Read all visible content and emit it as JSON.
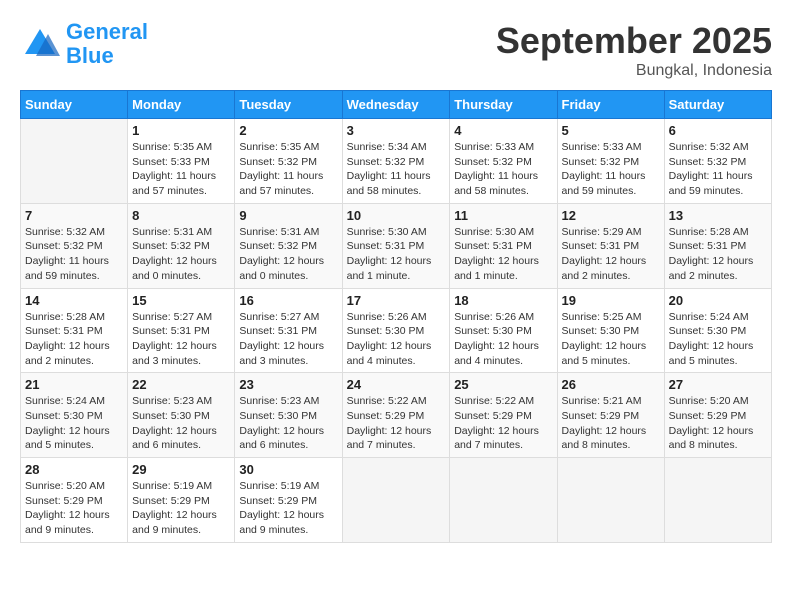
{
  "logo": {
    "line1": "General",
    "line2": "Blue"
  },
  "title": "September 2025",
  "subtitle": "Bungkal, Indonesia",
  "days_of_week": [
    "Sunday",
    "Monday",
    "Tuesday",
    "Wednesday",
    "Thursday",
    "Friday",
    "Saturday"
  ],
  "weeks": [
    [
      {
        "day": "",
        "info": ""
      },
      {
        "day": "1",
        "info": "Sunrise: 5:35 AM\nSunset: 5:33 PM\nDaylight: 11 hours\nand 57 minutes."
      },
      {
        "day": "2",
        "info": "Sunrise: 5:35 AM\nSunset: 5:32 PM\nDaylight: 11 hours\nand 57 minutes."
      },
      {
        "day": "3",
        "info": "Sunrise: 5:34 AM\nSunset: 5:32 PM\nDaylight: 11 hours\nand 58 minutes."
      },
      {
        "day": "4",
        "info": "Sunrise: 5:33 AM\nSunset: 5:32 PM\nDaylight: 11 hours\nand 58 minutes."
      },
      {
        "day": "5",
        "info": "Sunrise: 5:33 AM\nSunset: 5:32 PM\nDaylight: 11 hours\nand 59 minutes."
      },
      {
        "day": "6",
        "info": "Sunrise: 5:32 AM\nSunset: 5:32 PM\nDaylight: 11 hours\nand 59 minutes."
      }
    ],
    [
      {
        "day": "7",
        "info": "Sunrise: 5:32 AM\nSunset: 5:32 PM\nDaylight: 11 hours\nand 59 minutes."
      },
      {
        "day": "8",
        "info": "Sunrise: 5:31 AM\nSunset: 5:32 PM\nDaylight: 12 hours\nand 0 minutes."
      },
      {
        "day": "9",
        "info": "Sunrise: 5:31 AM\nSunset: 5:32 PM\nDaylight: 12 hours\nand 0 minutes."
      },
      {
        "day": "10",
        "info": "Sunrise: 5:30 AM\nSunset: 5:31 PM\nDaylight: 12 hours\nand 1 minute."
      },
      {
        "day": "11",
        "info": "Sunrise: 5:30 AM\nSunset: 5:31 PM\nDaylight: 12 hours\nand 1 minute."
      },
      {
        "day": "12",
        "info": "Sunrise: 5:29 AM\nSunset: 5:31 PM\nDaylight: 12 hours\nand 2 minutes."
      },
      {
        "day": "13",
        "info": "Sunrise: 5:28 AM\nSunset: 5:31 PM\nDaylight: 12 hours\nand 2 minutes."
      }
    ],
    [
      {
        "day": "14",
        "info": "Sunrise: 5:28 AM\nSunset: 5:31 PM\nDaylight: 12 hours\nand 2 minutes."
      },
      {
        "day": "15",
        "info": "Sunrise: 5:27 AM\nSunset: 5:31 PM\nDaylight: 12 hours\nand 3 minutes."
      },
      {
        "day": "16",
        "info": "Sunrise: 5:27 AM\nSunset: 5:31 PM\nDaylight: 12 hours\nand 3 minutes."
      },
      {
        "day": "17",
        "info": "Sunrise: 5:26 AM\nSunset: 5:30 PM\nDaylight: 12 hours\nand 4 minutes."
      },
      {
        "day": "18",
        "info": "Sunrise: 5:26 AM\nSunset: 5:30 PM\nDaylight: 12 hours\nand 4 minutes."
      },
      {
        "day": "19",
        "info": "Sunrise: 5:25 AM\nSunset: 5:30 PM\nDaylight: 12 hours\nand 5 minutes."
      },
      {
        "day": "20",
        "info": "Sunrise: 5:24 AM\nSunset: 5:30 PM\nDaylight: 12 hours\nand 5 minutes."
      }
    ],
    [
      {
        "day": "21",
        "info": "Sunrise: 5:24 AM\nSunset: 5:30 PM\nDaylight: 12 hours\nand 5 minutes."
      },
      {
        "day": "22",
        "info": "Sunrise: 5:23 AM\nSunset: 5:30 PM\nDaylight: 12 hours\nand 6 minutes."
      },
      {
        "day": "23",
        "info": "Sunrise: 5:23 AM\nSunset: 5:30 PM\nDaylight: 12 hours\nand 6 minutes."
      },
      {
        "day": "24",
        "info": "Sunrise: 5:22 AM\nSunset: 5:29 PM\nDaylight: 12 hours\nand 7 minutes."
      },
      {
        "day": "25",
        "info": "Sunrise: 5:22 AM\nSunset: 5:29 PM\nDaylight: 12 hours\nand 7 minutes."
      },
      {
        "day": "26",
        "info": "Sunrise: 5:21 AM\nSunset: 5:29 PM\nDaylight: 12 hours\nand 8 minutes."
      },
      {
        "day": "27",
        "info": "Sunrise: 5:20 AM\nSunset: 5:29 PM\nDaylight: 12 hours\nand 8 minutes."
      }
    ],
    [
      {
        "day": "28",
        "info": "Sunrise: 5:20 AM\nSunset: 5:29 PM\nDaylight: 12 hours\nand 9 minutes."
      },
      {
        "day": "29",
        "info": "Sunrise: 5:19 AM\nSunset: 5:29 PM\nDaylight: 12 hours\nand 9 minutes."
      },
      {
        "day": "30",
        "info": "Sunrise: 5:19 AM\nSunset: 5:29 PM\nDaylight: 12 hours\nand 9 minutes."
      },
      {
        "day": "",
        "info": ""
      },
      {
        "day": "",
        "info": ""
      },
      {
        "day": "",
        "info": ""
      },
      {
        "day": "",
        "info": ""
      }
    ]
  ]
}
